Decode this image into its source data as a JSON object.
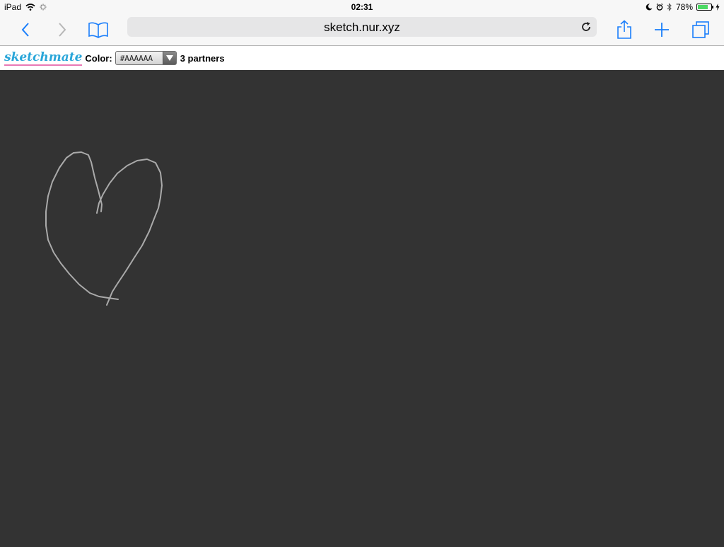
{
  "status": {
    "device": "iPad",
    "time": "02:31",
    "battery": "78%",
    "battery_level": 0.78
  },
  "browser": {
    "url": "sketch.nur.xyz"
  },
  "app": {
    "logo_text": "sketchmate",
    "color_label": "Color:",
    "color_value": "#AAAAAA",
    "partners": "3 partners",
    "stroke_color": "#aaaaaa",
    "canvas_color": "#333333"
  },
  "icons": {
    "back": "chevron-left-icon",
    "forward": "chevron-right-icon",
    "bookmarks": "book-icon",
    "reload": "reload-icon",
    "share": "share-icon",
    "new_tab": "plus-icon",
    "tabs": "tabs-icon"
  }
}
